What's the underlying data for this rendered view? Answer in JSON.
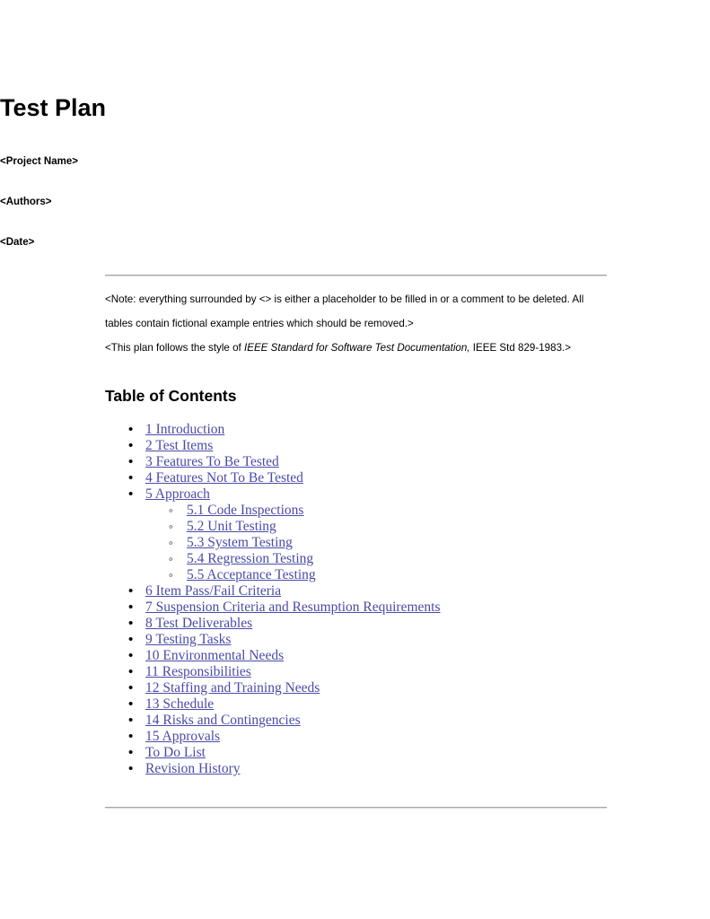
{
  "document": {
    "title": "Test Plan",
    "meta": {
      "project_name": "<Project Name>",
      "authors": "<Authors>",
      "date": "<Date>"
    },
    "notes": {
      "note_1": "<Note: everything surrounded by <> is either a placeholder to be filled in or a comment to be deleted. All tables contain fictional example entries which should be removed.>",
      "note_2_prefix": "<This plan follows the style of ",
      "note_2_italic": "IEEE Standard for Software Test Documentation,",
      "note_2_suffix": " IEEE Std 829-1983.>"
    },
    "toc": {
      "heading": "Table of Contents",
      "items": [
        {
          "label": "1 Introduction"
        },
        {
          "label": "2 Test Items"
        },
        {
          "label": "3 Features To Be Tested"
        },
        {
          "label": "4 Features Not To Be Tested"
        },
        {
          "label": "5 Approach",
          "children": [
            {
              "label": "5.1 Code Inspections"
            },
            {
              "label": "5.2 Unit Testing"
            },
            {
              "label": "5.3 System Testing"
            },
            {
              "label": "5.4 Regression Testing"
            },
            {
              "label": "5.5 Acceptance Testing"
            }
          ]
        },
        {
          "label": "6 Item Pass/Fail Criteria"
        },
        {
          "label": "7 Suspension Criteria and Resumption Requirements"
        },
        {
          "label": "8 Test Deliverables"
        },
        {
          "label": "9 Testing Tasks"
        },
        {
          "label": "10 Environmental Needs"
        },
        {
          "label": "11 Responsibilities"
        },
        {
          "label": "12 Staffing and Training Needs"
        },
        {
          "label": "13 Schedule"
        },
        {
          "label": "14 Risks and Contingencies"
        },
        {
          "label": "15 Approvals"
        },
        {
          "label": "To Do List"
        },
        {
          "label": "Revision History"
        }
      ]
    },
    "colors": {
      "link": "#4a4aa8",
      "rule": "#a6a6a6",
      "text": "#000000",
      "background": "#ffffff"
    }
  }
}
